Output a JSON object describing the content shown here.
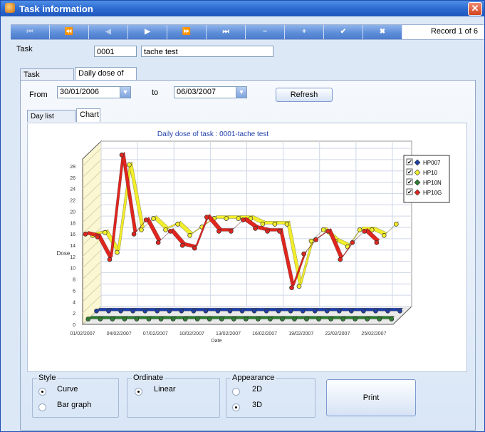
{
  "window": {
    "title": "Task information",
    "close_icon": "close-icon"
  },
  "navbar": {
    "buttons": [
      {
        "name": "first-record-button",
        "glyph": "⏮",
        "enabled": false
      },
      {
        "name": "prev-page-button",
        "glyph": "⏪",
        "enabled": false
      },
      {
        "name": "prev-record-button",
        "glyph": "◀",
        "enabled": false
      },
      {
        "name": "next-record-button",
        "glyph": "▶",
        "enabled": true
      },
      {
        "name": "next-page-button",
        "glyph": "⏩",
        "enabled": true
      },
      {
        "name": "last-record-button",
        "glyph": "⏭",
        "enabled": true
      },
      {
        "name": "delete-record-button",
        "glyph": "−",
        "enabled": true
      },
      {
        "name": "add-record-button",
        "glyph": "+",
        "enabled": true
      },
      {
        "name": "confirm-button",
        "glyph": "✔",
        "enabled": true
      },
      {
        "name": "cancel-button",
        "glyph": "✖",
        "enabled": true
      }
    ],
    "record_label": "Record 1 of 6"
  },
  "task": {
    "label": "Task",
    "code": "0001",
    "name": "tache test"
  },
  "tabs": {
    "task_info": "Task information",
    "daily_dose": "Daily dose of task"
  },
  "filter": {
    "from_label": "From",
    "from_value": "30/01/2006",
    "to_label": "to",
    "to_value": "06/03/2007",
    "refresh_label": "Refresh"
  },
  "subtabs": {
    "day_list": "Day list report",
    "chart": "Chart"
  },
  "options": {
    "style_label": "Style",
    "curve_label": "Curve",
    "bar_label": "Bar graph",
    "style_selected": "Curve",
    "ordinate_label": "Ordinate",
    "linear_label": "Linear",
    "ordinate_selected": "Linear",
    "appearance_label": "Appearance",
    "d2_label": "2D",
    "d3_label": "3D",
    "appearance_selected": "3D",
    "print_label": "Print"
  },
  "colors": {
    "hp007": "#1f3fa8",
    "hp10": "#f2ee2b",
    "hp10n": "#2e7d32",
    "hp10g": "#e0261f",
    "accent": "#2d6bd1"
  },
  "chart_data": {
    "type": "line",
    "title": "Daily dose of task : 0001-tache test",
    "xlabel": "Date",
    "ylabel": "Dose",
    "ylim": [
      0,
      28
    ],
    "yticks": [
      0,
      2,
      4,
      6,
      8,
      10,
      12,
      14,
      16,
      18,
      20,
      22,
      24,
      26,
      28
    ],
    "x_tick_labels": [
      "01/02/2007",
      "04/02/2007",
      "07/02/2007",
      "10/02/2007",
      "13/02/2007",
      "16/02/2007",
      "19/02/2007",
      "22/02/2007",
      "25/02/2007"
    ],
    "categories": [
      "01/02/2007",
      "02/02/2007",
      "03/02/2007",
      "04/02/2007",
      "05/02/2007",
      "06/02/2007",
      "07/02/2007",
      "08/02/2007",
      "09/02/2007",
      "10/02/2007",
      "11/02/2007",
      "12/02/2007",
      "13/02/2007",
      "14/02/2007",
      "15/02/2007",
      "16/02/2007",
      "17/02/2007",
      "18/02/2007",
      "19/02/2007",
      "20/02/2007",
      "21/02/2007",
      "22/02/2007",
      "23/02/2007",
      "24/02/2007",
      "25/02/2007",
      "26/02/2007"
    ],
    "series": [
      {
        "name": "HP007",
        "values": [
          0,
          0,
          0,
          0,
          0,
          0,
          0,
          0,
          0,
          0,
          0,
          0,
          0,
          0,
          0,
          0,
          0,
          0,
          0,
          0,
          0,
          0,
          0,
          0,
          0,
          0
        ]
      },
      {
        "name": "HP10",
        "values": [
          14,
          14.5,
          11,
          26.5,
          15,
          17,
          15,
          16,
          14,
          15.5,
          17,
          17,
          17,
          17,
          16,
          16,
          16,
          5,
          13,
          15,
          13,
          12,
          15,
          15,
          14,
          16
        ]
      },
      {
        "name": "HP10N",
        "values": [
          0,
          0,
          0,
          0,
          0,
          0,
          0,
          0,
          0,
          0,
          0,
          0,
          0,
          0,
          0,
          0,
          0,
          0,
          0,
          0,
          0,
          0,
          0,
          0,
          0,
          0
        ]
      },
      {
        "name": "HP10G",
        "values": [
          15.5,
          15,
          11,
          29.5,
          15.5,
          18,
          14,
          16,
          13.5,
          13,
          18.5,
          16,
          16,
          18,
          16.5,
          16,
          16,
          6,
          12,
          14.5,
          16,
          11,
          14,
          16,
          14,
          null
        ]
      }
    ],
    "legend_position": "right",
    "grid": true,
    "style": "3D"
  }
}
